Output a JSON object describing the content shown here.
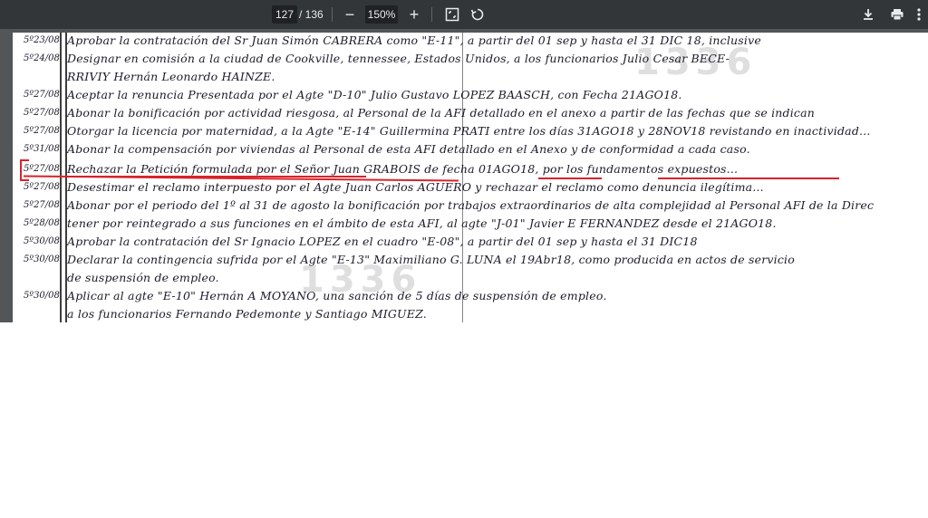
{
  "toolbar": {
    "current_page": "127",
    "page_separator": "/ 136",
    "zoom": "150%",
    "zoom_out_glyph": "−",
    "zoom_in_glyph": "+",
    "icons": [
      "fit-page-icon",
      "rotate-icon",
      "download-icon",
      "print-icon",
      "more-vert-icon"
    ]
  },
  "document": {
    "watermark_top": "1336",
    "watermark_bottom": "1336",
    "rows": [
      {
        "date": "5º23/08",
        "text": "Aprobar la contratación del Sr Juan Simón CABRERA como \"E-11\", a partir del 01 sep y hasta el 31 DIC 18, inclusive"
      },
      {
        "date": "5º24/08",
        "text": "Designar en comisión a la ciudad de Cookville, tennessee, Estados Unidos, a los funcionarios Julio Cesar BECE-"
      },
      {
        "date": "",
        "text": "RRIVIY Hernán Leonardo HAINZE."
      },
      {
        "date": "5º27/08",
        "text": "Aceptar la renuncia Presentada por el Agte \"D-10\" Julio Gustavo LOPEZ BAASCH, con Fecha 21AGO18."
      },
      {
        "date": "5º27/08",
        "text": "Abonar la bonificación por actividad riesgosa, al Personal de la AFI detallado en el anexo a partir de las fechas que se indican"
      },
      {
        "date": "5º27/08",
        "text": "Otorgar la licencia por maternidad, a la Agte \"E-14\" Guillermina PRATI entre los días 31AGO18 y 28NOV18 revistando en inactividad..."
      },
      {
        "date": "5º31/08",
        "text": "Abonar la compensación por viviendas al Personal de esta AFI detallado en el Anexo y de conformidad a cada caso."
      },
      {
        "date": "5º27/08",
        "text": "Rechazar la Petición formulada por el Señor Juan GRABOIS de fecha 01AGO18, por los fundamentos expuestos..."
      },
      {
        "date": "5º27/08",
        "text": "Desestimar el reclamo interpuesto por el Agte Juan Carlos AGUERO y rechazar el reclamo como denuncia ilegítima..."
      },
      {
        "date": "5º27/08",
        "text": "Abonar por el periodo del 1º al 31 de agosto la bonificación por trabajos extraordinarios de alta complejidad al Personal AFI de la Direc"
      },
      {
        "date": "5º28/08",
        "text": "tener por reintegrado a sus funciones en el ámbito de esta AFI, al agte \"J-01\" Javier E FERNANDEZ desde el 21AGO18."
      },
      {
        "date": "5º30/08",
        "text": "Aprobar la contratación del Sr Ignacio LOPEZ en el cuadro \"E-08\", a partir del 01 sep y hasta el 31 DIC18"
      },
      {
        "date": "5º30/08",
        "text": "Declarar la contingencia sufrida por el Agte \"E-13\" Maximiliano G. LUNA el 19Abr18, como producida en actos de servicio"
      },
      {
        "date": "",
        "text": "de suspensión de empleo."
      },
      {
        "date": "5º30/08",
        "text": "Aplicar al agte \"E-10\" Hernán A MOYANO, una sanción de 5 días de suspensión de empleo."
      },
      {
        "date": "",
        "text": "a los funcionarios Fernando Pedemonte y Santiago MIGUEZ."
      }
    ]
  }
}
